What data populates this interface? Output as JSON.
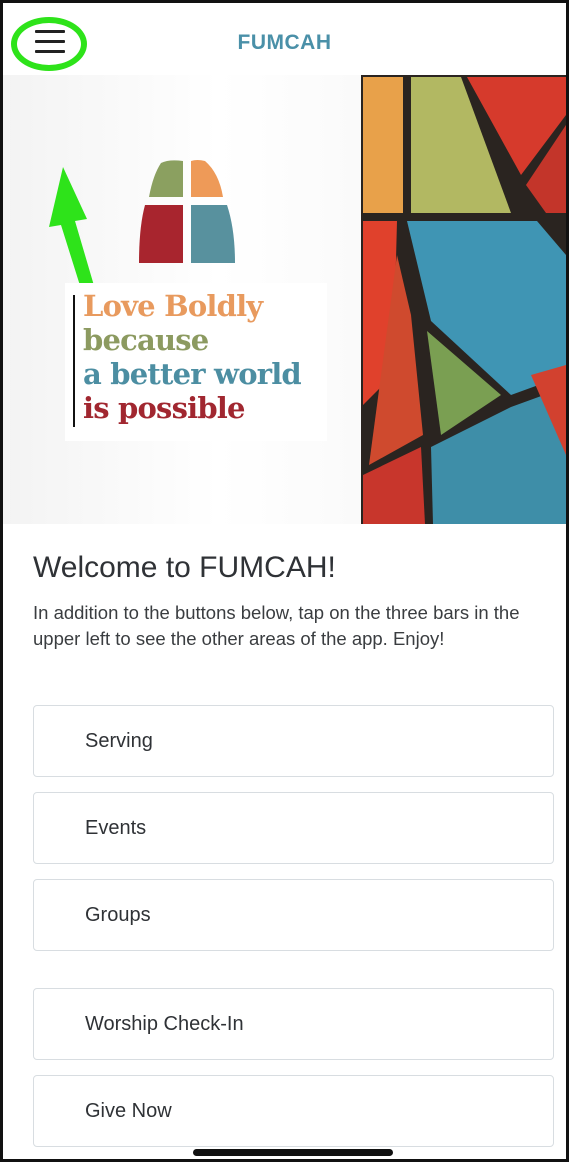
{
  "header": {
    "title": "FUMCAH",
    "menu_icon": "hamburger-menu-icon"
  },
  "banner": {
    "tagline": [
      "Love Boldly",
      "because",
      "a better world",
      "is possible"
    ],
    "tagline_colors": [
      "#e89a5e",
      "#8c9a60",
      "#4c8ea2",
      "#a12730"
    ]
  },
  "welcome": {
    "title": "Welcome to FUMCAH!",
    "text": "In addition to the buttons below, tap on the three bars in the upper left to see the other areas of the app. Enjoy!"
  },
  "buttons": [
    {
      "label": "Serving"
    },
    {
      "label": "Events"
    },
    {
      "label": "Groups"
    },
    {
      "label": "Worship Check-In"
    },
    {
      "label": "Give Now"
    }
  ],
  "colors": {
    "accent": "#4a90a8",
    "annotation": "#2ee31a"
  }
}
